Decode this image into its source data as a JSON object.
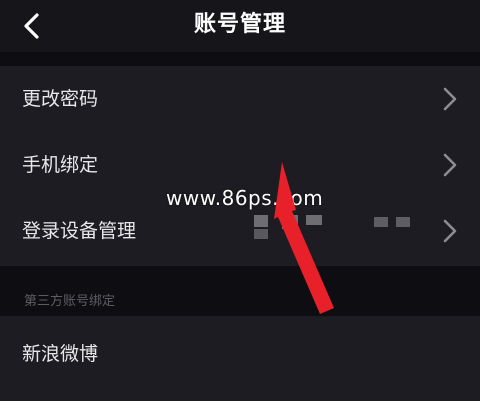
{
  "header": {
    "title": "账号管理",
    "back_icon": "chevron-left-icon"
  },
  "settings": {
    "items": [
      {
        "label": "更改密码",
        "icon": "chevron-right-icon"
      },
      {
        "label": "手机绑定",
        "value": "",
        "icon": "chevron-right-icon"
      },
      {
        "label": "登录设备管理",
        "icon": "chevron-right-icon"
      }
    ]
  },
  "third_party": {
    "section_title": "第三方账号绑定",
    "items": [
      {
        "label": "新浪微博"
      }
    ]
  },
  "overlay": {
    "watermark": "www.86ps.com",
    "arrow_color": "#e8202a"
  },
  "colors": {
    "background": "#141418",
    "row_background": "#1c1c22",
    "text": "#e8e8ea",
    "section_text": "#5c5c62"
  }
}
